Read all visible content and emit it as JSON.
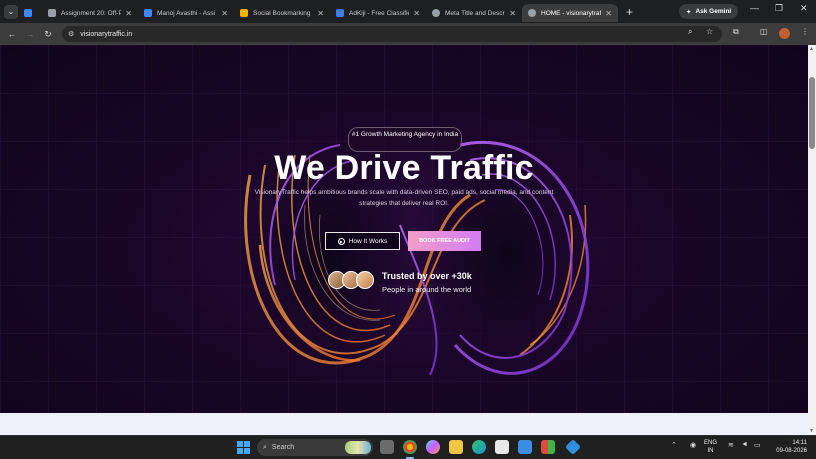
{
  "browser": {
    "tabs": [
      {
        "title": "",
        "favicon_color": "#4285f4"
      },
      {
        "title": "Assignment 20: Off-P",
        "favicon_color": "#9aa0a6"
      },
      {
        "title": "Manoj Avasthi - Assi",
        "favicon_color": "#4285f4"
      },
      {
        "title": "Social Bookmarking",
        "favicon_color": "#f4b400"
      },
      {
        "title": "AdKiji - Free Classifie",
        "favicon_color": "#3f7be0"
      },
      {
        "title": "Meta Title and Descr",
        "favicon_color": "#9aa0a6"
      },
      {
        "title": "HOME - visionarytraf",
        "favicon_color": "#9aa0a6"
      }
    ],
    "new_tab_symbol": "+",
    "gemini_label": "Ask Gemini",
    "url": "visionarytraffic.in",
    "window_controls": {
      "minimize": "—",
      "maximize": "❐",
      "close": "✕"
    }
  },
  "hero": {
    "badge": "#1 Growth Marketing Agency in India",
    "headline": "We Drive Traffic",
    "subtitle": "VisionaryTraffic helps ambitious brands scale with data-driven SEO, paid ads, social media, and content strategies that deliver real ROI.",
    "primary_button": "How It Works",
    "secondary_button": "BOOK FREE AUDIT",
    "trusted_title": "Trusted by over +30k",
    "trusted_sub": "People in around the world"
  },
  "taskbar": {
    "search_placeholder": "Search",
    "language": "ENG",
    "region": "IN",
    "time": "14:11",
    "date": "09-08-2026"
  },
  "colors": {
    "accent_pink": "#f29ec8",
    "accent_purple": "#d27cf2",
    "hero_bg": "#1a0628"
  }
}
